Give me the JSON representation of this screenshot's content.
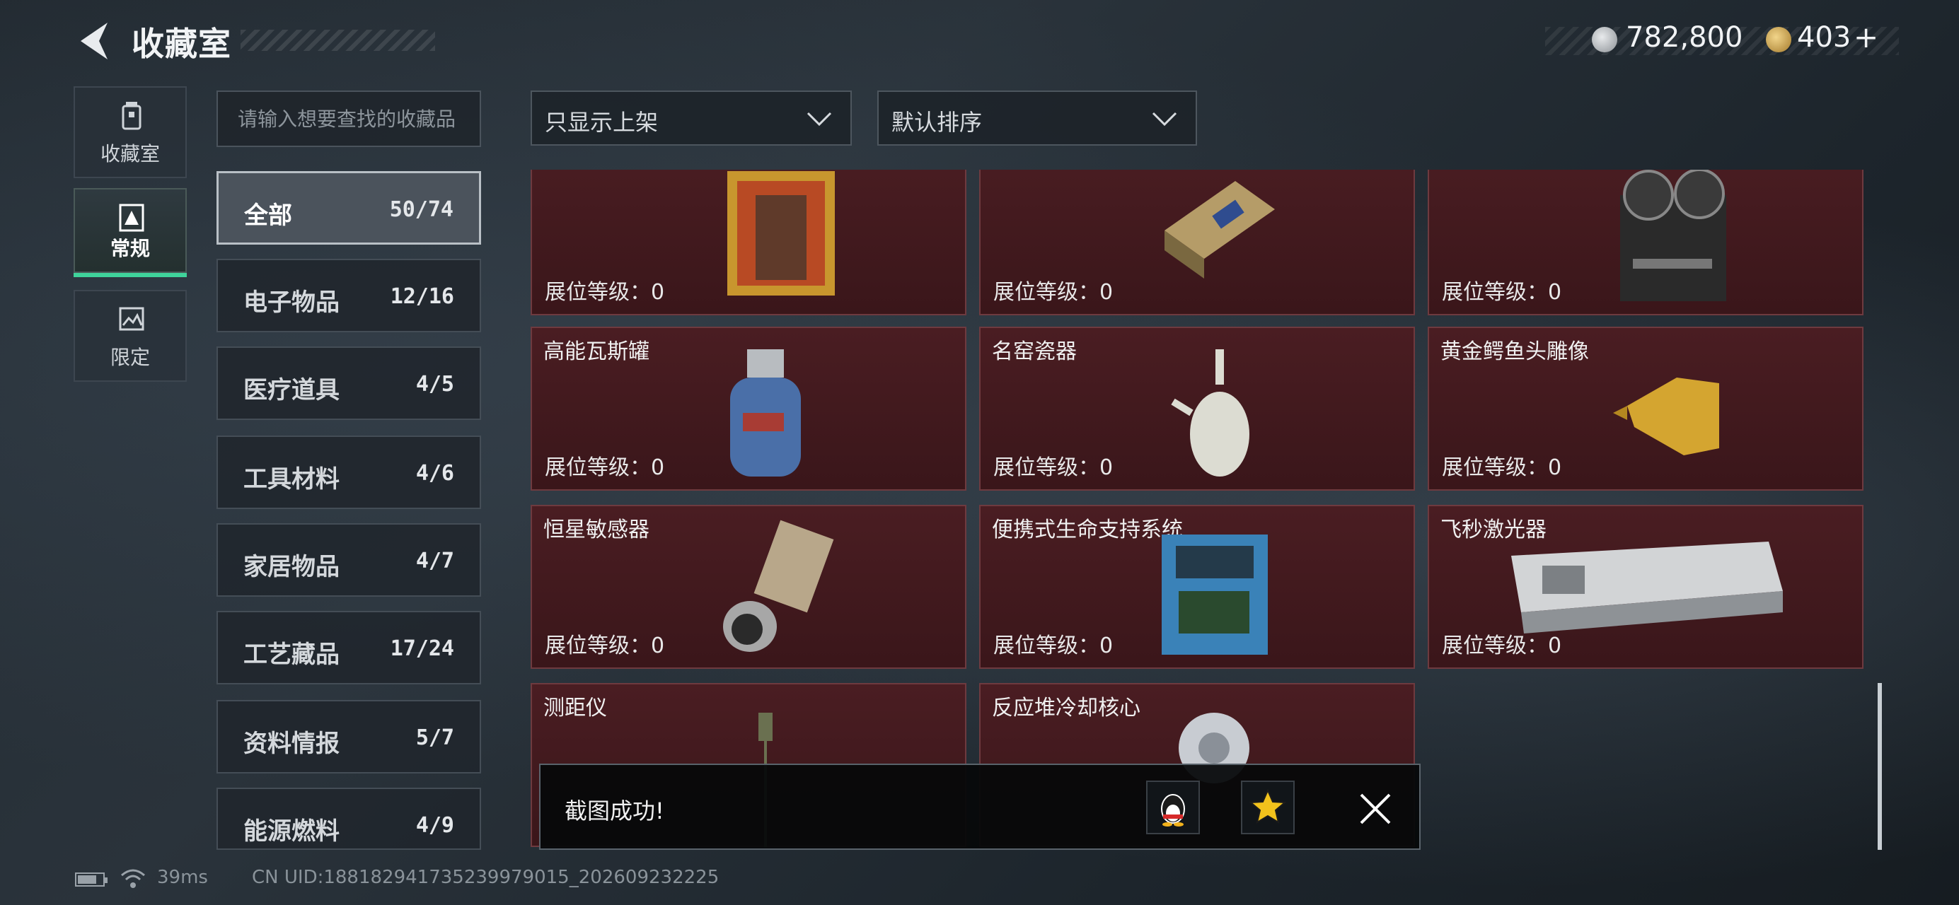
{
  "header": {
    "title": "收藏室",
    "currency_silver": "782,800",
    "currency_gold": "403",
    "add_label": "+"
  },
  "nav": [
    {
      "label": "收藏室",
      "icon": "trash-can-icon"
    },
    {
      "label": "常规",
      "icon": "document-icon"
    },
    {
      "label": "限定",
      "icon": "image-icon"
    }
  ],
  "search": {
    "placeholder": "请输入想要查找的收藏品"
  },
  "filters": {
    "shelf": "只显示上架",
    "sort": "默认排序"
  },
  "categories": [
    {
      "name": "全部",
      "count": "50/74"
    },
    {
      "name": "电子物品",
      "count": "12/16"
    },
    {
      "name": "医疗道具",
      "count": "4/5"
    },
    {
      "name": "工具材料",
      "count": "4/6"
    },
    {
      "name": "家居物品",
      "count": "4/7"
    },
    {
      "name": "工艺藏品",
      "count": "17/24"
    },
    {
      "name": "资料情报",
      "count": "5/7"
    },
    {
      "name": "能源燃料",
      "count": "4/9"
    }
  ],
  "level_label": "展位等级：0",
  "items": [
    {
      "name": "",
      "art": "painting"
    },
    {
      "name": "",
      "art": "device"
    },
    {
      "name": "",
      "art": "tape-recorder"
    },
    {
      "name": "高能瓦斯罐",
      "art": "gas-tank"
    },
    {
      "name": "名窑瓷器",
      "art": "vase"
    },
    {
      "name": "黄金鳄鱼头雕像",
      "art": "gold-statue"
    },
    {
      "name": "恒星敏感器",
      "art": "sensor"
    },
    {
      "name": "便携式生命支持系统",
      "art": "life-support"
    },
    {
      "name": "飞秒激光器",
      "art": "laser"
    },
    {
      "name": "测距仪",
      "art": "rangefinder"
    },
    {
      "name": "反应堆冷却核心",
      "art": "reactor-core"
    }
  ],
  "toast": {
    "message": "截图成功!"
  },
  "footer": {
    "ping": "39ms",
    "uid": "CN UID:18818294173523997901​5_202609232225"
  },
  "colors": {
    "accent": "#3fd39b",
    "card_bg": "#4a1d22"
  }
}
